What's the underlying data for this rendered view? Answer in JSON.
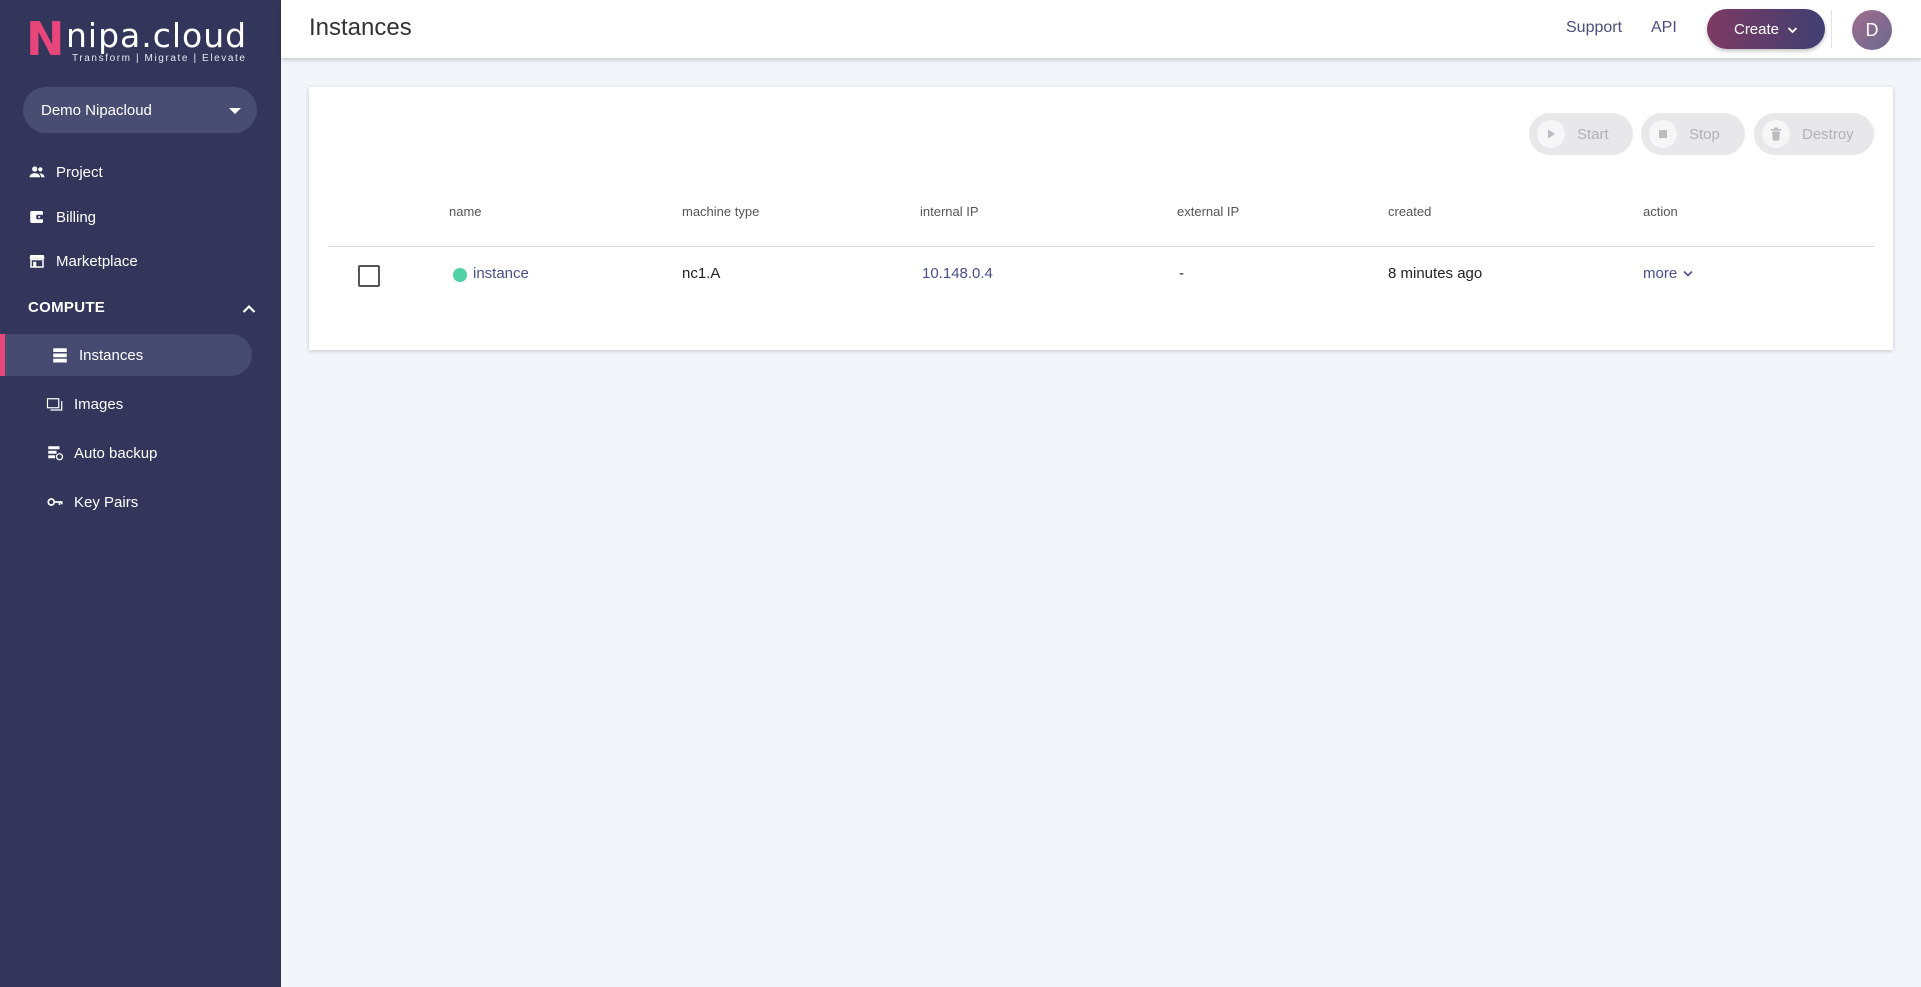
{
  "brand": {
    "logo_letter": "N",
    "logo_text": "nipa.cloud",
    "tagline": "Transform  |  Migrate  |  Elevate",
    "accent_color": "#e8457a",
    "sidebar_color": "#33365a"
  },
  "org_selector": {
    "value": "Demo Nipacloud",
    "icon": "caret-down-icon"
  },
  "sidebar": {
    "items": [
      {
        "label": "Project",
        "icon": "people-icon"
      },
      {
        "label": "Billing",
        "icon": "wallet-icon"
      },
      {
        "label": "Marketplace",
        "icon": "store-icon"
      }
    ],
    "section": {
      "label": "COMPUTE",
      "icon": "chevron-up-icon"
    },
    "sub_items": [
      {
        "label": "Instances",
        "icon": "server-icon",
        "active": true
      },
      {
        "label": "Images",
        "icon": "image-stack-icon",
        "active": false
      },
      {
        "label": "Auto backup",
        "icon": "backup-icon",
        "active": false
      },
      {
        "label": "Key Pairs",
        "icon": "key-icon",
        "active": false
      }
    ]
  },
  "header": {
    "title": "Instances",
    "support_label": "Support",
    "api_label": "API",
    "create_label": "Create",
    "avatar_initial": "D"
  },
  "toolbar": {
    "start_label": "Start",
    "stop_label": "Stop",
    "destroy_label": "Destroy"
  },
  "table": {
    "columns": [
      "name",
      "machine type",
      "internal IP",
      "external IP",
      "created",
      "action"
    ],
    "rows": [
      {
        "name": "instance",
        "status": "running",
        "status_color": "#4fd1a5",
        "machine_type": "nc1.A",
        "internal_ip": "10.148.0.4",
        "external_ip": "-",
        "created": "8 minutes ago",
        "action": "more"
      }
    ]
  }
}
